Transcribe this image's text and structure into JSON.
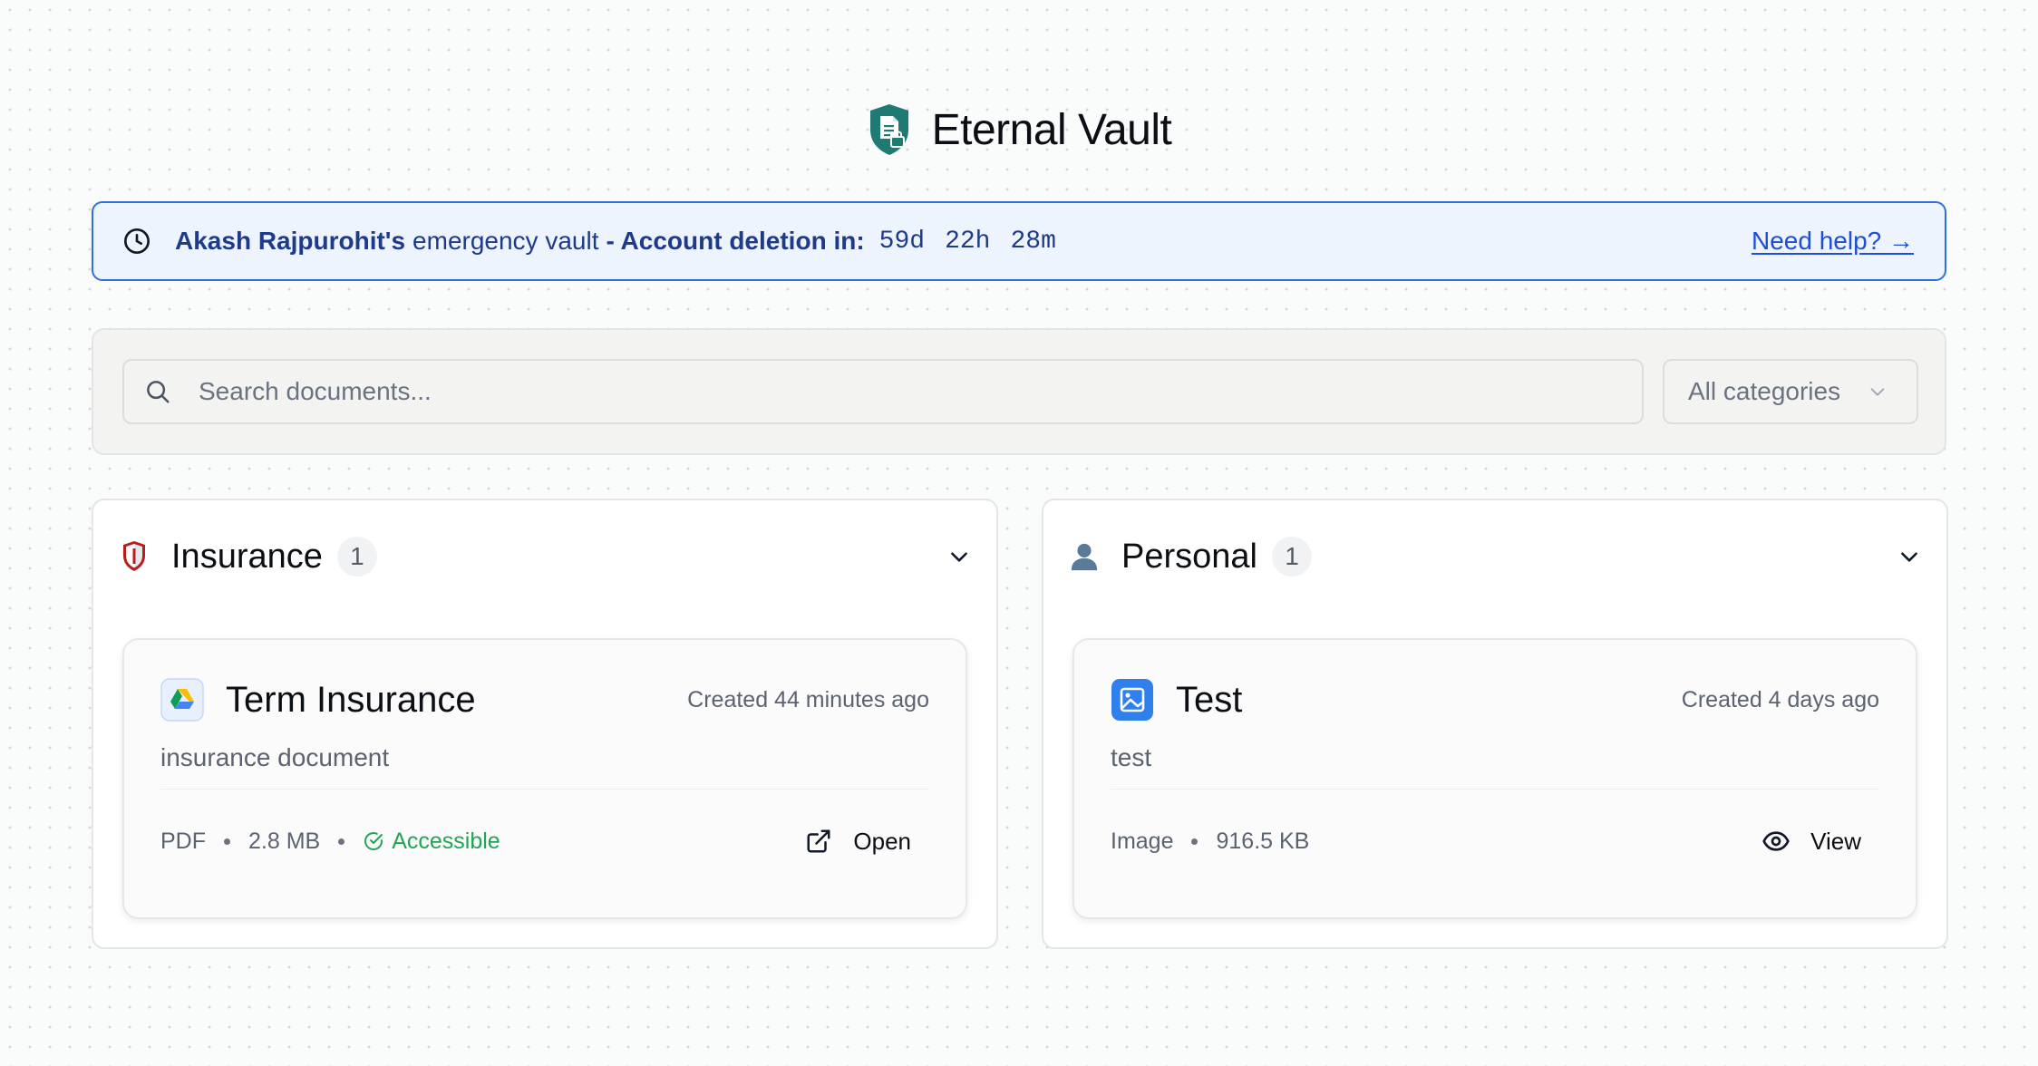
{
  "brand": {
    "title": "Eternal Vault",
    "logo_icon": "shield-document-lock-icon",
    "color": "#1f7a73"
  },
  "banner": {
    "owner": "Akash Rajpurohit's",
    "text": "emergency vault",
    "deletion_label": "- Account deletion in:",
    "countdown": {
      "days": "59d",
      "hours": "22h",
      "minutes": "28m"
    },
    "help_link": "Need help? →",
    "accent_color": "#2f6fe0"
  },
  "search": {
    "placeholder": "Search documents...",
    "value": "",
    "category_selected": "All categories"
  },
  "categories": [
    {
      "emoji_icon": "shield-emoji-icon",
      "title": "Insurance",
      "count": "1",
      "documents": [
        {
          "icon": "google-drive-icon",
          "title": "Term Insurance",
          "created": "Created 44 minutes ago",
          "description": "insurance document",
          "type": "PDF",
          "size": "2.8 MB",
          "status": "Accessible",
          "action_label": "Open",
          "action_icon": "external-link-icon"
        }
      ]
    },
    {
      "emoji_icon": "person-silhouette-icon",
      "title": "Personal",
      "count": "1",
      "documents": [
        {
          "icon": "image-file-icon",
          "title": "Test",
          "created": "Created 4 days ago",
          "description": "test",
          "type": "Image",
          "size": "916.5 KB",
          "action_label": "View",
          "action_icon": "eye-icon"
        }
      ]
    }
  ]
}
